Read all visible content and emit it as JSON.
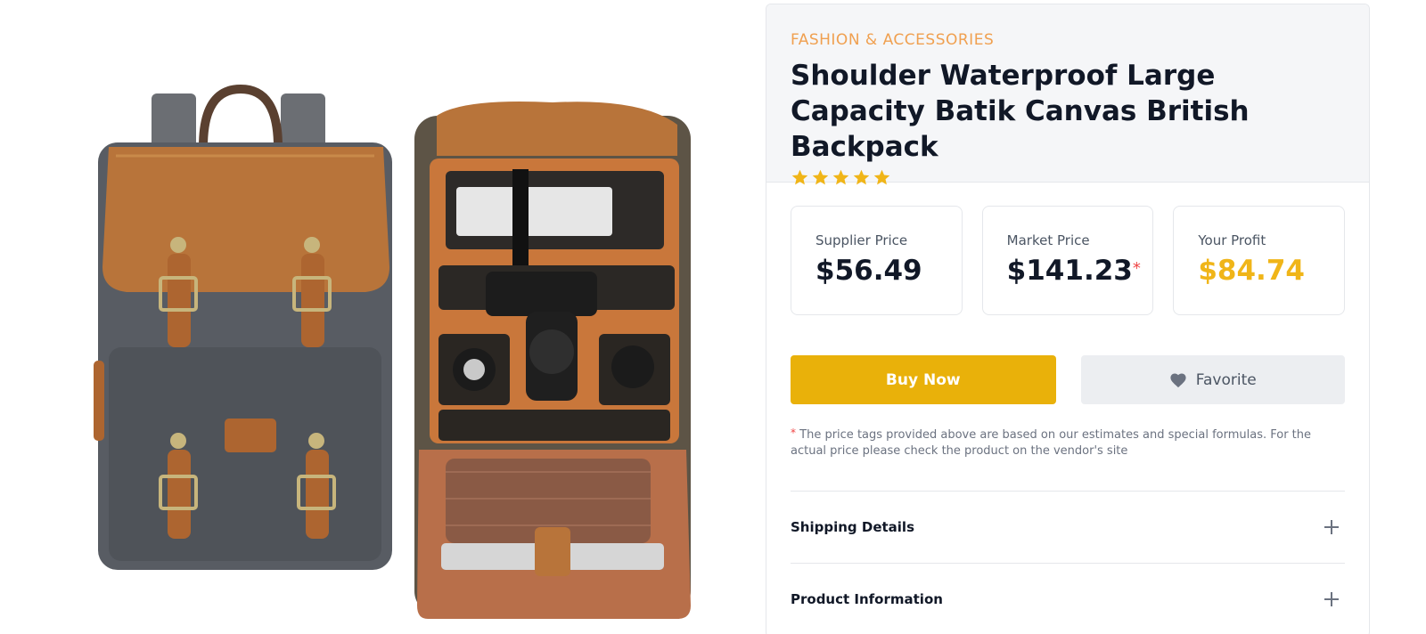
{
  "product": {
    "category": "FASHION & ACCESSORIES",
    "title": "Shoulder Waterproof Large Capacity Batik Canvas British Backpack",
    "rating": 5,
    "image_alt_icon": "backpack-image"
  },
  "prices": {
    "supplier_label": "Supplier Price",
    "supplier_value": "$56.49",
    "market_label": "Market Price",
    "market_value": "$141.23",
    "market_asterisk": "*",
    "profit_label": "Your Profit",
    "profit_value": "$84.74"
  },
  "actions": {
    "buy_label": "Buy Now",
    "favorite_label": "Favorite"
  },
  "note": {
    "asterisk": "*",
    "text": "The price tags provided above are based on our estimates and special formulas. For the actual price please check the product on the vendor's site"
  },
  "accordion": {
    "shipping_label": "Shipping Details",
    "info_label": "Product Information"
  },
  "colors": {
    "accent": "#e9b10a",
    "profit": "#f0b518",
    "category": "#f0a050",
    "star": "#f0b518"
  }
}
